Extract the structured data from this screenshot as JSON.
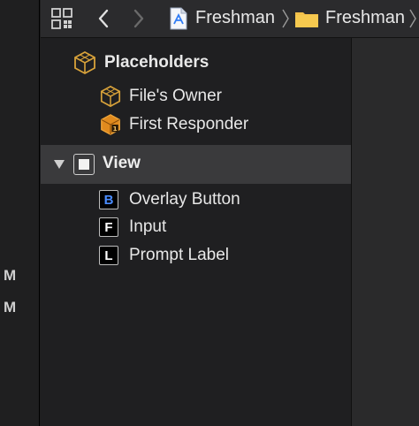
{
  "jump_bar": {
    "crumbs": [
      "Freshman",
      "Freshman"
    ]
  },
  "gutter": {
    "letters": [
      "M",
      "M"
    ]
  },
  "outline": {
    "placeholders": {
      "label": "Placeholders",
      "items": [
        "File's Owner",
        "First Responder"
      ]
    },
    "view": {
      "label": "View",
      "children": [
        {
          "badge": "B",
          "label": "Overlay Button"
        },
        {
          "badge": "F",
          "label": "Input"
        },
        {
          "badge": "L",
          "label": "Prompt Label"
        }
      ]
    }
  },
  "colors": {
    "cube": "#d8a23a",
    "button_badge": "#4a8cff",
    "folder": "#f3c04a",
    "selection": "#3a3a3c"
  }
}
